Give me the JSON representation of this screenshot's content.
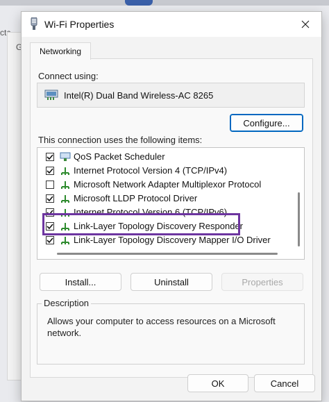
{
  "dialog": {
    "title": "Wi-Fi Properties",
    "tab": "Networking"
  },
  "connect_using": {
    "label": "Connect using:",
    "adapter": "Intel(R) Dual Band Wireless-AC 8265"
  },
  "buttons": {
    "configure": "Configure...",
    "install": "Install...",
    "uninstall": "Uninstall",
    "properties": "Properties",
    "ok": "OK",
    "cancel": "Cancel"
  },
  "items_label": "This connection uses the following items:",
  "items": [
    {
      "label": "QoS Packet Scheduler",
      "checked": true,
      "icon": "qos-icon"
    },
    {
      "label": "Internet Protocol Version 4 (TCP/IPv4)",
      "checked": true,
      "icon": "network-protocol-icon"
    },
    {
      "label": "Microsoft Network Adapter Multiplexor Protocol",
      "checked": false,
      "icon": "network-protocol-icon"
    },
    {
      "label": "Microsoft LLDP Protocol Driver",
      "checked": true,
      "icon": "network-protocol-icon"
    },
    {
      "label": "Internet Protocol Version 6 (TCP/IPv6)",
      "checked": true,
      "icon": "network-protocol-icon"
    },
    {
      "label": "Link-Layer Topology Discovery Responder",
      "checked": true,
      "icon": "network-protocol-icon"
    },
    {
      "label": "Link-Layer Topology Discovery Mapper I/O Driver",
      "checked": true,
      "icon": "network-protocol-icon"
    }
  ],
  "description": {
    "legend": "Description",
    "text": "Allows your computer to access resources on a Microsoft network."
  },
  "background": {
    "partial_text_1": "ctc",
    "partial_text_2": "G"
  },
  "colors": {
    "highlight": "#6d35a0",
    "accent": "#0067c0"
  }
}
